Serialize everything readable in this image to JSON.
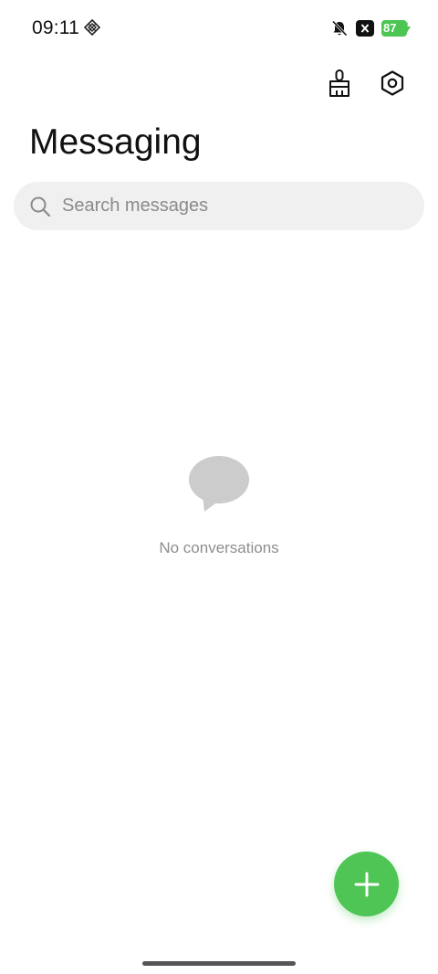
{
  "status_bar": {
    "time": "09:11",
    "battery_level": "87",
    "battery_color": "#4cc553"
  },
  "header": {
    "title": "Messaging",
    "actions": [
      {
        "icon": "broom-icon",
        "label": ""
      },
      {
        "icon": "settings-icon",
        "label": ""
      }
    ]
  },
  "search": {
    "placeholder": "Search messages",
    "value": ""
  },
  "empty_state": {
    "icon": "chat-bubble-icon",
    "text": "No conversations"
  },
  "fab": {
    "icon": "plus-icon",
    "color": "#4fc556"
  }
}
